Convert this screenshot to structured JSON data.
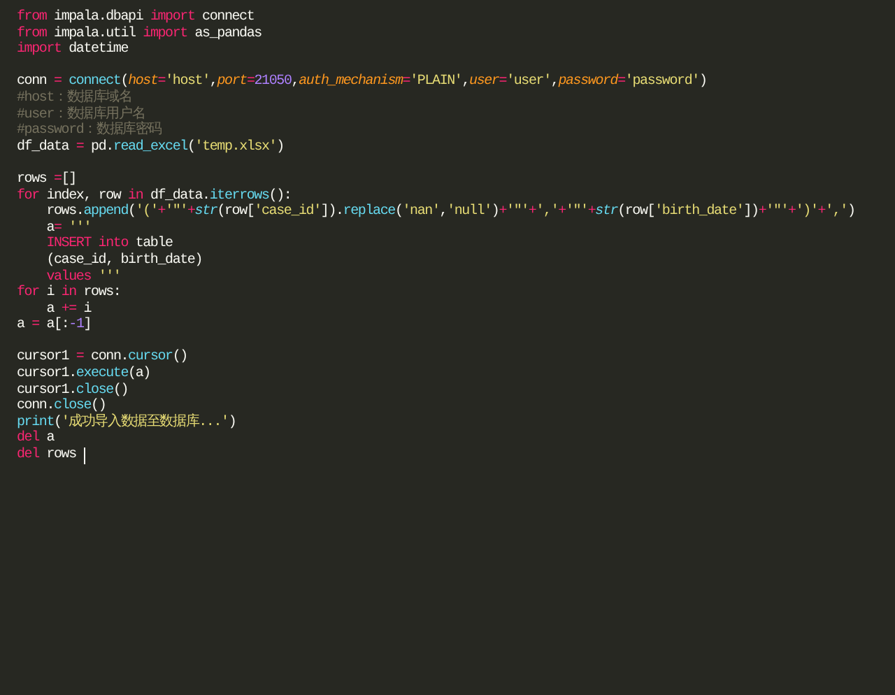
{
  "editor": {
    "lines": [
      {
        "kind": "code",
        "cursor": false,
        "tokens": [
          {
            "kind": "kw",
            "text": "from"
          },
          {
            "kind": "txt",
            "text": " impala.dbapi "
          },
          {
            "kind": "kw",
            "text": "import"
          },
          {
            "kind": "txt",
            "text": " connect"
          }
        ]
      },
      {
        "kind": "code",
        "cursor": false,
        "tokens": [
          {
            "kind": "kw",
            "text": "from"
          },
          {
            "kind": "txt",
            "text": " impala.util "
          },
          {
            "kind": "kw",
            "text": "import"
          },
          {
            "kind": "txt",
            "text": " as_pandas"
          }
        ]
      },
      {
        "kind": "code",
        "cursor": false,
        "tokens": [
          {
            "kind": "kw",
            "text": "import"
          },
          {
            "kind": "txt",
            "text": " datetime"
          }
        ]
      },
      {
        "kind": "blank",
        "cursor": false
      },
      {
        "kind": "code",
        "cursor": false,
        "tokens": [
          {
            "kind": "txt",
            "text": "conn "
          },
          {
            "kind": "op",
            "text": "="
          },
          {
            "kind": "fn",
            "text": " connect"
          },
          {
            "kind": "txt",
            "text": "("
          },
          {
            "kind": "par",
            "text": "host"
          },
          {
            "kind": "op",
            "text": "="
          },
          {
            "kind": "str",
            "text": "'host'"
          },
          {
            "kind": "txt",
            "text": ","
          },
          {
            "kind": "par",
            "text": "port"
          },
          {
            "kind": "op",
            "text": "="
          },
          {
            "kind": "num",
            "text": "21050"
          },
          {
            "kind": "txt",
            "text": ","
          },
          {
            "kind": "par",
            "text": "auth_mechanism"
          },
          {
            "kind": "op",
            "text": "="
          },
          {
            "kind": "str",
            "text": "'PLAIN'"
          },
          {
            "kind": "txt",
            "text": ","
          },
          {
            "kind": "par",
            "text": "user"
          },
          {
            "kind": "op",
            "text": "="
          },
          {
            "kind": "str",
            "text": "'user'"
          },
          {
            "kind": "txt",
            "text": ","
          },
          {
            "kind": "par",
            "text": "password"
          },
          {
            "kind": "op",
            "text": "="
          },
          {
            "kind": "str",
            "text": "'password'"
          },
          {
            "kind": "txt",
            "text": ")"
          }
        ]
      },
      {
        "kind": "code",
        "cursor": false,
        "tokens": [
          {
            "kind": "com",
            "text": "#host：数据库域名"
          }
        ]
      },
      {
        "kind": "code",
        "cursor": false,
        "tokens": [
          {
            "kind": "com",
            "text": "#user：数据库用户名"
          }
        ]
      },
      {
        "kind": "code",
        "cursor": false,
        "tokens": [
          {
            "kind": "com",
            "text": "#password：数据库密码"
          }
        ]
      },
      {
        "kind": "code",
        "cursor": false,
        "tokens": [
          {
            "kind": "txt",
            "text": "df_data "
          },
          {
            "kind": "op",
            "text": "="
          },
          {
            "kind": "txt",
            "text": " pd."
          },
          {
            "kind": "fn",
            "text": "read_excel"
          },
          {
            "kind": "txt",
            "text": "("
          },
          {
            "kind": "str",
            "text": "'temp.xlsx'"
          },
          {
            "kind": "txt",
            "text": ")"
          }
        ]
      },
      {
        "kind": "blank",
        "cursor": false
      },
      {
        "kind": "code",
        "cursor": false,
        "tokens": [
          {
            "kind": "txt",
            "text": "rows "
          },
          {
            "kind": "op",
            "text": "="
          },
          {
            "kind": "txt",
            "text": "[]"
          }
        ]
      },
      {
        "kind": "code",
        "cursor": false,
        "tokens": [
          {
            "kind": "kw",
            "text": "for"
          },
          {
            "kind": "txt",
            "text": " index, row "
          },
          {
            "kind": "kw",
            "text": "in"
          },
          {
            "kind": "txt",
            "text": " df_data."
          },
          {
            "kind": "fn",
            "text": "iterrows"
          },
          {
            "kind": "txt",
            "text": "():"
          }
        ]
      },
      {
        "kind": "code",
        "cursor": false,
        "tokens": [
          {
            "kind": "txt",
            "text": "    rows."
          },
          {
            "kind": "fn",
            "text": "append"
          },
          {
            "kind": "txt",
            "text": "("
          },
          {
            "kind": "str",
            "text": "'('"
          },
          {
            "kind": "op",
            "text": "+"
          },
          {
            "kind": "str",
            "text": "'\"'"
          },
          {
            "kind": "op",
            "text": "+"
          },
          {
            "kind": "fni",
            "text": "str"
          },
          {
            "kind": "txt",
            "text": "(row["
          },
          {
            "kind": "str",
            "text": "'case_id'"
          },
          {
            "kind": "txt",
            "text": "])."
          },
          {
            "kind": "fn",
            "text": "replace"
          },
          {
            "kind": "txt",
            "text": "("
          },
          {
            "kind": "str",
            "text": "'nan'"
          },
          {
            "kind": "txt",
            "text": ","
          },
          {
            "kind": "str",
            "text": "'null'"
          },
          {
            "kind": "txt",
            "text": ")"
          },
          {
            "kind": "op",
            "text": "+"
          },
          {
            "kind": "str",
            "text": "'\"'"
          },
          {
            "kind": "op",
            "text": "+"
          },
          {
            "kind": "str",
            "text": "','"
          },
          {
            "kind": "op",
            "text": "+"
          },
          {
            "kind": "str",
            "text": "'\"'"
          },
          {
            "kind": "op",
            "text": "+"
          },
          {
            "kind": "fni",
            "text": "str"
          },
          {
            "kind": "txt",
            "text": "(row["
          },
          {
            "kind": "str",
            "text": "'birth_date'"
          },
          {
            "kind": "txt",
            "text": "])"
          },
          {
            "kind": "op",
            "text": "+"
          },
          {
            "kind": "str",
            "text": "'\"'"
          },
          {
            "kind": "op",
            "text": "+"
          },
          {
            "kind": "str",
            "text": "')'"
          },
          {
            "kind": "op",
            "text": "+"
          },
          {
            "kind": "str",
            "text": "','"
          },
          {
            "kind": "txt",
            "text": ")"
          }
        ]
      },
      {
        "kind": "code",
        "cursor": false,
        "tokens": [
          {
            "kind": "txt",
            "text": "    a"
          },
          {
            "kind": "op",
            "text": "="
          },
          {
            "kind": "str",
            "text": " '''"
          }
        ]
      },
      {
        "kind": "code",
        "cursor": false,
        "tokens": [
          {
            "kind": "kw",
            "text": "    INSERT into"
          },
          {
            "kind": "txt",
            "text": " table"
          }
        ]
      },
      {
        "kind": "code",
        "cursor": false,
        "tokens": [
          {
            "kind": "txt",
            "text": "    (case_id, birth_date)"
          }
        ]
      },
      {
        "kind": "code",
        "cursor": false,
        "tokens": [
          {
            "kind": "kw",
            "text": "    values"
          },
          {
            "kind": "str",
            "text": " '''"
          }
        ]
      },
      {
        "kind": "code",
        "cursor": false,
        "tokens": [
          {
            "kind": "kw",
            "text": "for"
          },
          {
            "kind": "txt",
            "text": " i "
          },
          {
            "kind": "kw",
            "text": "in"
          },
          {
            "kind": "txt",
            "text": " rows:"
          }
        ]
      },
      {
        "kind": "code",
        "cursor": false,
        "tokens": [
          {
            "kind": "txt",
            "text": "    a "
          },
          {
            "kind": "op",
            "text": "+="
          },
          {
            "kind": "txt",
            "text": " i"
          }
        ]
      },
      {
        "kind": "code",
        "cursor": false,
        "tokens": [
          {
            "kind": "txt",
            "text": "a "
          },
          {
            "kind": "op",
            "text": "="
          },
          {
            "kind": "txt",
            "text": " a[:"
          },
          {
            "kind": "num",
            "text": "-1"
          },
          {
            "kind": "txt",
            "text": "]"
          }
        ]
      },
      {
        "kind": "blank",
        "cursor": false
      },
      {
        "kind": "code",
        "cursor": false,
        "tokens": [
          {
            "kind": "txt",
            "text": "cursor1 "
          },
          {
            "kind": "op",
            "text": "="
          },
          {
            "kind": "txt",
            "text": " conn."
          },
          {
            "kind": "fn",
            "text": "cursor"
          },
          {
            "kind": "txt",
            "text": "()"
          }
        ]
      },
      {
        "kind": "code",
        "cursor": false,
        "tokens": [
          {
            "kind": "txt",
            "text": "cursor1."
          },
          {
            "kind": "fn",
            "text": "execute"
          },
          {
            "kind": "txt",
            "text": "(a)"
          }
        ]
      },
      {
        "kind": "code",
        "cursor": false,
        "tokens": [
          {
            "kind": "txt",
            "text": "cursor1."
          },
          {
            "kind": "fn",
            "text": "close"
          },
          {
            "kind": "txt",
            "text": "()"
          }
        ]
      },
      {
        "kind": "code",
        "cursor": false,
        "tokens": [
          {
            "kind": "txt",
            "text": "conn."
          },
          {
            "kind": "fn",
            "text": "close"
          },
          {
            "kind": "txt",
            "text": "()"
          }
        ]
      },
      {
        "kind": "code",
        "cursor": false,
        "tokens": [
          {
            "kind": "fn",
            "text": "print"
          },
          {
            "kind": "txt",
            "text": "("
          },
          {
            "kind": "str",
            "text": "'成功导入数据至数据库...'"
          },
          {
            "kind": "txt",
            "text": ")"
          }
        ]
      },
      {
        "kind": "code",
        "cursor": false,
        "tokens": [
          {
            "kind": "kw",
            "text": "del"
          },
          {
            "kind": "txt",
            "text": " a"
          }
        ]
      },
      {
        "kind": "code",
        "cursor": true,
        "tokens": [
          {
            "kind": "kw",
            "text": "del"
          },
          {
            "kind": "txt",
            "text": " rows "
          }
        ]
      }
    ]
  }
}
